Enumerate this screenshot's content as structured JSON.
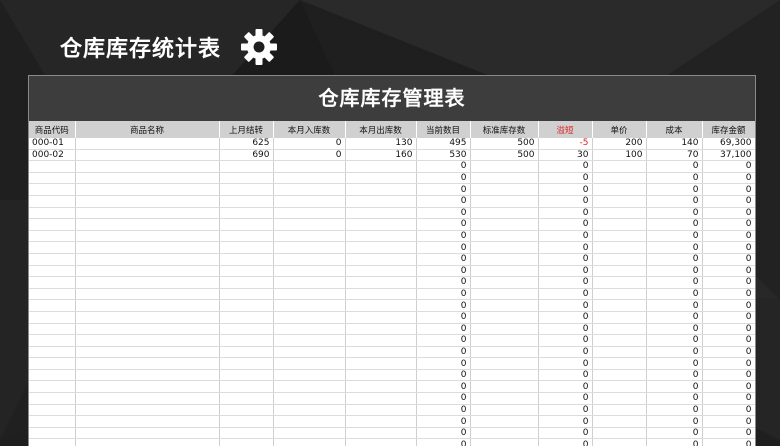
{
  "header": {
    "title": "仓库库存统计表",
    "icon": "gear-icon"
  },
  "sheet": {
    "title": "仓库库存管理表",
    "columns": [
      "商品代码",
      "商品名称",
      "上月结转",
      "本月入库数",
      "本月出库数",
      "当前数目",
      "标准库存数",
      "溢短",
      "单价",
      "成本",
      "库存金额"
    ],
    "rows": [
      [
        "000-01",
        "",
        "625",
        "0",
        "130",
        "495",
        "500",
        "-5",
        "200",
        "140",
        "69,300"
      ],
      [
        "000-02",
        "",
        "690",
        "0",
        "160",
        "530",
        "500",
        "30",
        "100",
        "70",
        "37,100"
      ]
    ],
    "zero_value": "0",
    "empty_rows": 26
  },
  "colors": {
    "background": "#1e1e1e",
    "sheet_title_bg": "#3d3d3d",
    "header_row_bg": "#d0d0d0",
    "negative": "#e02020"
  }
}
